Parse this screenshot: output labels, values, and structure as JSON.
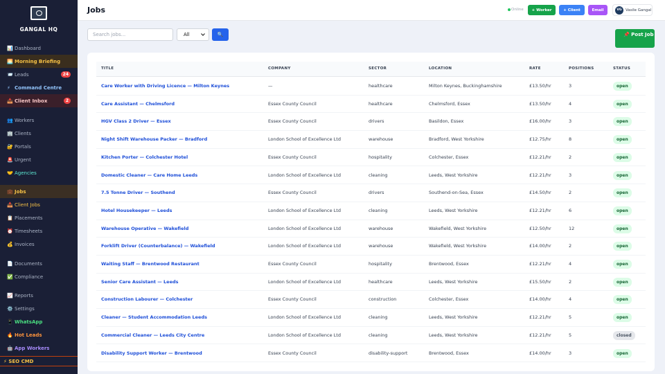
{
  "app": {
    "brand": "GANGAL HQ",
    "logo_text": "GANGAL"
  },
  "sidebar": {
    "items": [
      {
        "icon": "📊",
        "label": "Dashboard"
      },
      {
        "icon": "🌅",
        "label": "Morning Briefing"
      },
      {
        "icon": "📨",
        "label": "Leads",
        "badge": "24"
      },
      {
        "icon": "⚡",
        "label": "Command Centre"
      },
      {
        "icon": "📥",
        "label": "Client Inbox",
        "badge": "2"
      },
      {
        "icon": "👥",
        "label": "Workers"
      },
      {
        "icon": "🏢",
        "label": "Clients"
      },
      {
        "icon": "🔐",
        "label": "Portals"
      },
      {
        "icon": "🚨",
        "label": "Urgent"
      },
      {
        "icon": "🤝",
        "label": "Agencies"
      },
      {
        "icon": "💼",
        "label": "Jobs"
      },
      {
        "icon": "📥",
        "label": "Client Jobs"
      },
      {
        "icon": "📋",
        "label": "Placements"
      },
      {
        "icon": "⏰",
        "label": "Timesheets"
      },
      {
        "icon": "💰",
        "label": "Invoices"
      },
      {
        "icon": "📄",
        "label": "Documents"
      },
      {
        "icon": "✅",
        "label": "Compliance"
      },
      {
        "icon": "📈",
        "label": "Reports"
      },
      {
        "icon": "⚙️",
        "label": "Settings"
      },
      {
        "icon": "📱",
        "label": "WhatsApp"
      },
      {
        "icon": "🔥",
        "label": "Hot Leads"
      },
      {
        "icon": "🤖",
        "label": "App Workers"
      }
    ],
    "seo": "⚡ SEO CMD"
  },
  "header": {
    "title": "Jobs",
    "online": "Online",
    "btn_worker": "+ Worker",
    "btn_client": "+ Client",
    "btn_email": "Email",
    "user_initials": "VG",
    "user_name": "Vasile Gangal"
  },
  "filters": {
    "search_placeholder": "Search jobs...",
    "status_value": "All",
    "search_button_icon": "🔍",
    "post_job": "📌 Post Job"
  },
  "table": {
    "headers": {
      "title": "TITLE",
      "company": "COMPANY",
      "sector": "SECTOR",
      "location": "LOCATION",
      "rate": "RATE",
      "positions": "POSITIONS",
      "status": "STATUS"
    },
    "rows": [
      {
        "title": "Care Worker with Driving Licence — Milton Keynes",
        "company": "—",
        "sector": "healthcare",
        "location": "Milton Keynes, Buckinghamshire",
        "rate": "£13.50/hr",
        "positions": "3",
        "status": "open"
      },
      {
        "title": "Care Assistant — Chelmsford",
        "company": "Essex County Council",
        "sector": "healthcare",
        "location": "Chelmsford, Essex",
        "rate": "£13.50/hr",
        "positions": "4",
        "status": "open"
      },
      {
        "title": "HGV Class 2 Driver — Essex",
        "company": "Essex County Council",
        "sector": "drivers",
        "location": "Basildon, Essex",
        "rate": "£16.00/hr",
        "positions": "3",
        "status": "open"
      },
      {
        "title": "Night Shift Warehouse Packer — Bradford",
        "company": "London School of Excellence Ltd",
        "sector": "warehouse",
        "location": "Bradford, West Yorkshire",
        "rate": "£12.75/hr",
        "positions": "8",
        "status": "open"
      },
      {
        "title": "Kitchen Porter — Colchester Hotel",
        "company": "Essex County Council",
        "sector": "hospitality",
        "location": "Colchester, Essex",
        "rate": "£12.21/hr",
        "positions": "2",
        "status": "open"
      },
      {
        "title": "Domestic Cleaner — Care Home Leeds",
        "company": "London School of Excellence Ltd",
        "sector": "cleaning",
        "location": "Leeds, West Yorkshire",
        "rate": "£12.21/hr",
        "positions": "3",
        "status": "open"
      },
      {
        "title": "7.5 Tonne Driver — Southend",
        "company": "Essex County Council",
        "sector": "drivers",
        "location": "Southend-on-Sea, Essex",
        "rate": "£14.50/hr",
        "positions": "2",
        "status": "open"
      },
      {
        "title": "Hotel Housekeeper — Leeds",
        "company": "London School of Excellence Ltd",
        "sector": "cleaning",
        "location": "Leeds, West Yorkshire",
        "rate": "£12.21/hr",
        "positions": "6",
        "status": "open"
      },
      {
        "title": "Warehouse Operative — Wakefield",
        "company": "London School of Excellence Ltd",
        "sector": "warehouse",
        "location": "Wakefield, West Yorkshire",
        "rate": "£12.50/hr",
        "positions": "12",
        "status": "open"
      },
      {
        "title": "Forklift Driver (Counterbalance) — Wakefield",
        "company": "London School of Excellence Ltd",
        "sector": "warehouse",
        "location": "Wakefield, West Yorkshire",
        "rate": "£14.00/hr",
        "positions": "2",
        "status": "open"
      },
      {
        "title": "Waiting Staff — Brentwood Restaurant",
        "company": "Essex County Council",
        "sector": "hospitality",
        "location": "Brentwood, Essex",
        "rate": "£12.21/hr",
        "positions": "4",
        "status": "open"
      },
      {
        "title": "Senior Care Assistant — Leeds",
        "company": "London School of Excellence Ltd",
        "sector": "healthcare",
        "location": "Leeds, West Yorkshire",
        "rate": "£15.50/hr",
        "positions": "2",
        "status": "open"
      },
      {
        "title": "Construction Labourer — Colchester",
        "company": "Essex County Council",
        "sector": "construction",
        "location": "Colchester, Essex",
        "rate": "£14.00/hr",
        "positions": "4",
        "status": "open"
      },
      {
        "title": "Cleaner — Student Accommodation Leeds",
        "company": "London School of Excellence Ltd",
        "sector": "cleaning",
        "location": "Leeds, West Yorkshire",
        "rate": "£12.21/hr",
        "positions": "5",
        "status": "open"
      },
      {
        "title": "Commercial Cleaner — Leeds City Centre",
        "company": "London School of Excellence Ltd",
        "sector": "cleaning",
        "location": "Leeds, West Yorkshire",
        "rate": "£12.21/hr",
        "positions": "5",
        "status": "closed"
      },
      {
        "title": "Disability Support Worker — Brentwood",
        "company": "Essex County Council",
        "sector": "disability-support",
        "location": "Brentwood, Essex",
        "rate": "£14.00/hr",
        "positions": "3",
        "status": "open"
      }
    ]
  }
}
